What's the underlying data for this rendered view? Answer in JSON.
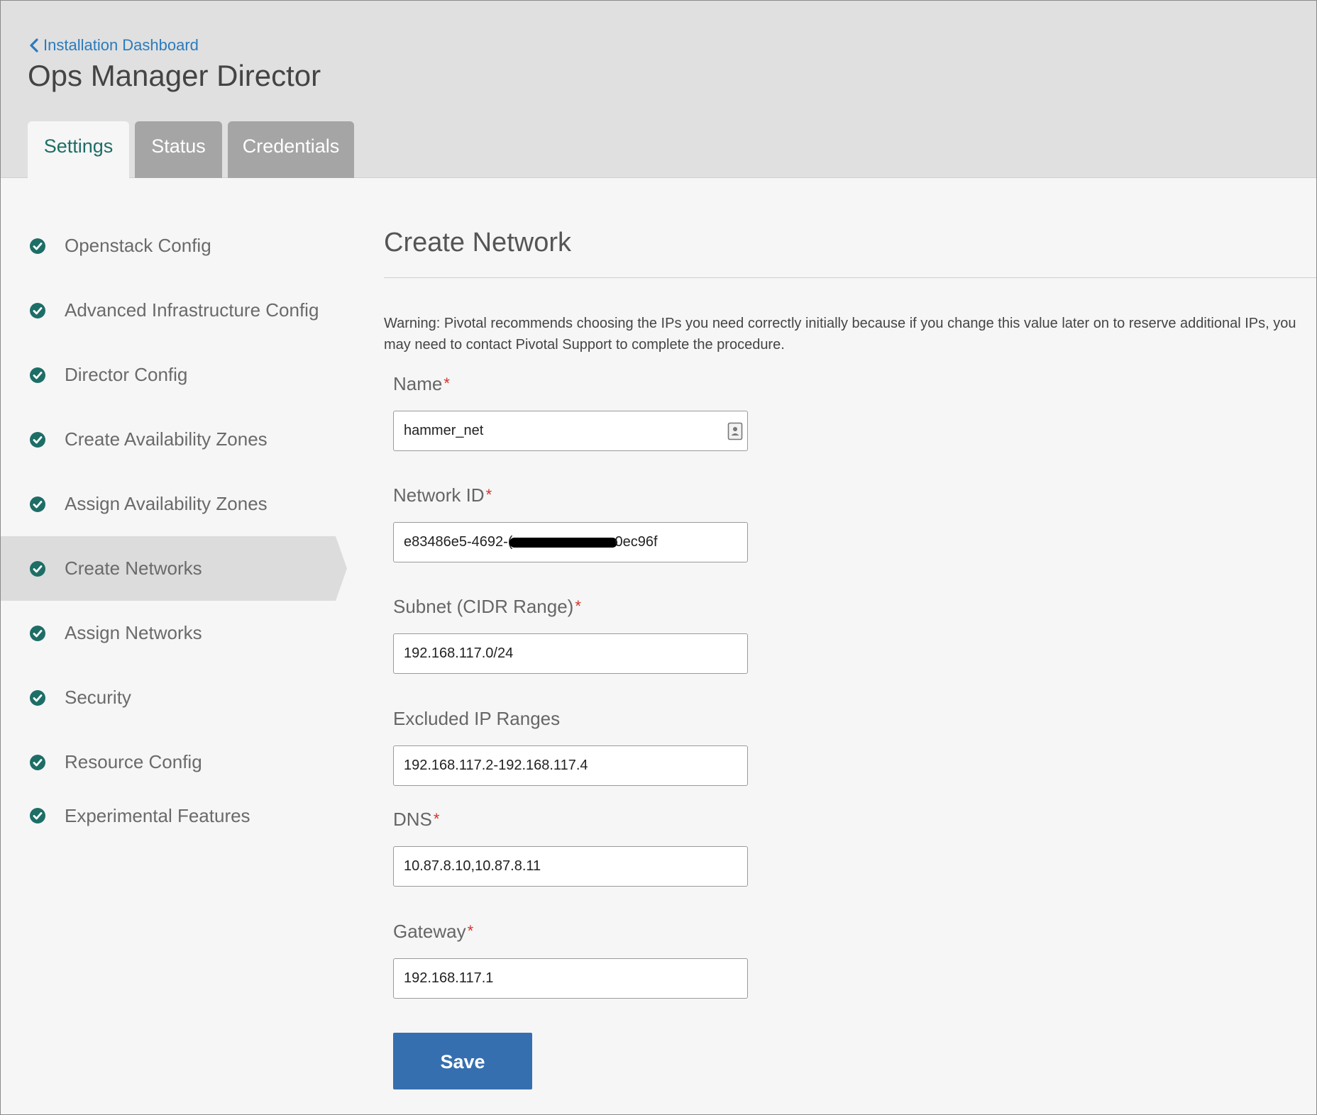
{
  "header": {
    "back_link": "Installation Dashboard",
    "title": "Ops Manager Director",
    "tabs": [
      {
        "label": "Settings",
        "active": true
      },
      {
        "label": "Status",
        "active": false
      },
      {
        "label": "Credentials",
        "active": false
      }
    ]
  },
  "sidebar": {
    "items": [
      {
        "label": "Openstack Config",
        "complete": true
      },
      {
        "label": "Advanced Infrastructure Config",
        "complete": true
      },
      {
        "label": "Director Config",
        "complete": true
      },
      {
        "label": "Create Availability Zones",
        "complete": true
      },
      {
        "label": "Assign Availability Zones",
        "complete": true
      },
      {
        "label": "Create Networks",
        "complete": true,
        "active": true
      },
      {
        "label": "Assign Networks",
        "complete": true
      },
      {
        "label": "Security",
        "complete": true
      },
      {
        "label": "Resource Config",
        "complete": true
      },
      {
        "label": "Experimental Features",
        "complete": true
      }
    ]
  },
  "main": {
    "title": "Create Network",
    "warning": "Warning: Pivotal recommends choosing the IPs you need correctly initially because if you change this value later on to reserve additional IPs, you may need to contact Pivotal Support to complete the procedure.",
    "fields": {
      "name": {
        "label": "Name",
        "required": true,
        "value": "hammer_net"
      },
      "network_id": {
        "label": "Network ID",
        "required": true,
        "value_prefix": "e83486e5-4692-(",
        "value_suffix": "0ec96f"
      },
      "subnet": {
        "label": "Subnet (CIDR Range)",
        "required": true,
        "value": "192.168.117.0/24"
      },
      "excluded": {
        "label": "Excluded IP Ranges",
        "required": false,
        "value": "192.168.117.2-192.168.117.4"
      },
      "dns": {
        "label": "DNS",
        "required": true,
        "value": "10.87.8.10,10.87.8.11"
      },
      "gateway": {
        "label": "Gateway",
        "required": true,
        "value": "192.168.117.1"
      }
    },
    "required_marker": "*",
    "save_label": "Save"
  },
  "colors": {
    "accent_green": "#1d6e66",
    "link_blue": "#2b7bbd",
    "button_blue": "#356fb0",
    "required_red": "#d0342c"
  },
  "icons": {
    "check": "check-circle-icon",
    "back": "chevron-left-icon",
    "contact": "contact-card-icon"
  }
}
